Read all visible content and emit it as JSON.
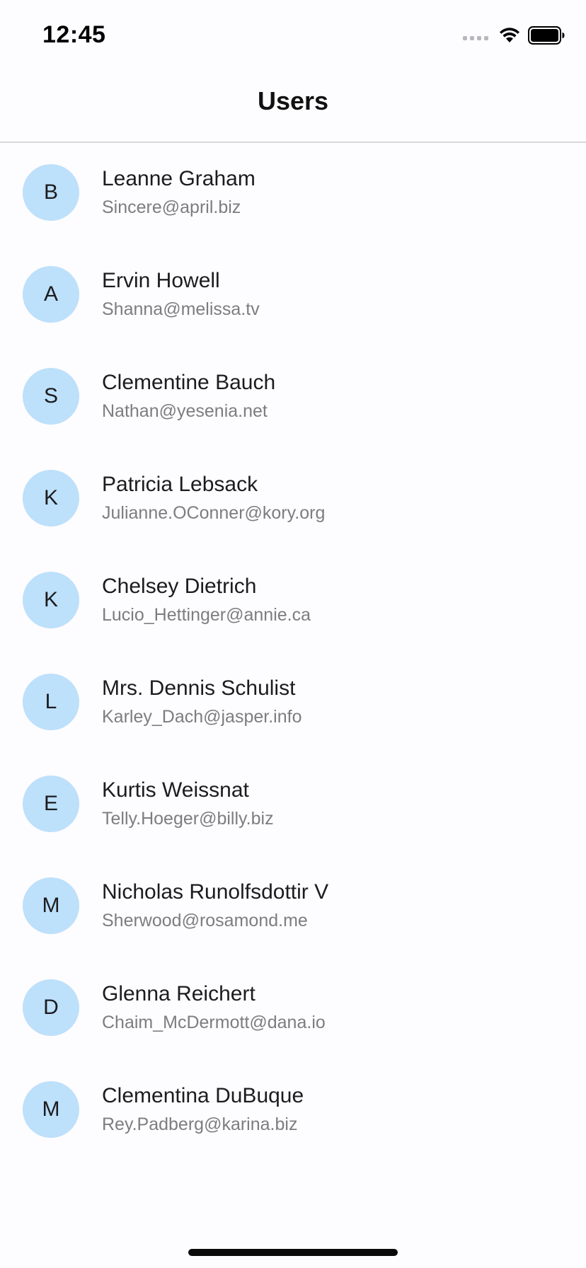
{
  "status_bar": {
    "time": "12:45",
    "icons": [
      "cellular-signal-icon",
      "wifi-icon",
      "battery-icon"
    ]
  },
  "header": {
    "title": "Users"
  },
  "colors": {
    "avatar_background": "#bde0fb",
    "email_text": "#7d7d80",
    "background": "#fdfcfe"
  },
  "users": [
    {
      "initial": "B",
      "name": "Leanne Graham",
      "email": "Sincere@april.biz"
    },
    {
      "initial": "A",
      "name": "Ervin Howell",
      "email": "Shanna@melissa.tv"
    },
    {
      "initial": "S",
      "name": "Clementine Bauch",
      "email": "Nathan@yesenia.net"
    },
    {
      "initial": "K",
      "name": "Patricia Lebsack",
      "email": "Julianne.OConner@kory.org"
    },
    {
      "initial": "K",
      "name": "Chelsey Dietrich",
      "email": "Lucio_Hettinger@annie.ca"
    },
    {
      "initial": "L",
      "name": "Mrs. Dennis Schulist",
      "email": "Karley_Dach@jasper.info"
    },
    {
      "initial": "E",
      "name": "Kurtis Weissnat",
      "email": "Telly.Hoeger@billy.biz"
    },
    {
      "initial": "M",
      "name": "Nicholas Runolfsdottir V",
      "email": "Sherwood@rosamond.me"
    },
    {
      "initial": "D",
      "name": "Glenna Reichert",
      "email": "Chaim_McDermott@dana.io"
    },
    {
      "initial": "M",
      "name": "Clementina DuBuque",
      "email": "Rey.Padberg@karina.biz"
    }
  ]
}
